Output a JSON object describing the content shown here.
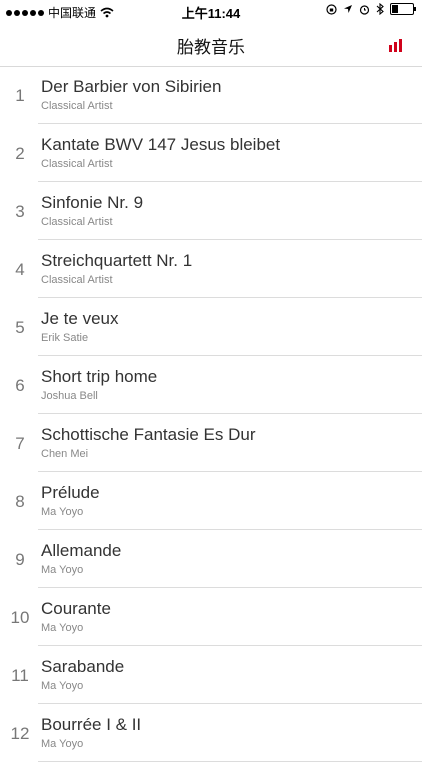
{
  "status_bar": {
    "carrier": "中国联通",
    "time": "上午11:44",
    "battery_level": 0.25
  },
  "header": {
    "title": "胎教音乐",
    "right_icon": "signal-bars-icon",
    "accent_color": "#d0021b"
  },
  "tracks": [
    {
      "num": "1",
      "title": "Der Barbier von Sibirien",
      "artist": "Classical Artist"
    },
    {
      "num": "2",
      "title": "Kantate BWV 147 Jesus bleibet",
      "artist": "Classical Artist"
    },
    {
      "num": "3",
      "title": "Sinfonie Nr. 9",
      "artist": "Classical Artist"
    },
    {
      "num": "4",
      "title": "Streichquartett Nr. 1",
      "artist": "Classical Artist"
    },
    {
      "num": "5",
      "title": "Je te veux",
      "artist": "Erik Satie"
    },
    {
      "num": "6",
      "title": "Short trip home",
      "artist": "Joshua Bell"
    },
    {
      "num": "7",
      "title": "Schottische Fantasie Es Dur",
      "artist": "Chen Mei"
    },
    {
      "num": "8",
      "title": "Prélude",
      "artist": "Ma Yoyo"
    },
    {
      "num": "9",
      "title": "Allemande",
      "artist": "Ma Yoyo"
    },
    {
      "num": "10",
      "title": "Courante",
      "artist": "Ma Yoyo"
    },
    {
      "num": "11",
      "title": "Sarabande",
      "artist": "Ma Yoyo"
    },
    {
      "num": "12",
      "title": "Bourrée I & II",
      "artist": "Ma Yoyo"
    }
  ]
}
